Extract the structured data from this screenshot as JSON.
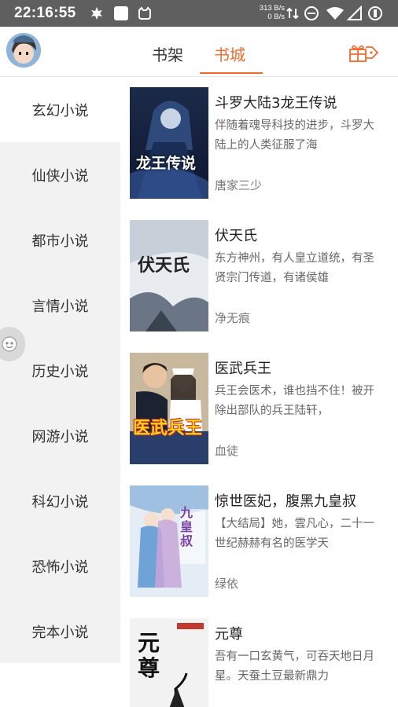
{
  "status_bar": {
    "time": "22:16:55",
    "upload_speed": "313 B/s",
    "download_speed": "0 B/s"
  },
  "header": {
    "tabs": [
      {
        "label": "书架",
        "active": false
      },
      {
        "label": "书城",
        "active": true
      }
    ]
  },
  "colors": {
    "accent": "#f06a2c",
    "sidebar_bg": "#f2f2f2",
    "status_bar_bg": "#5f5f5f"
  },
  "categories": [
    {
      "label": "玄幻小说",
      "active": true
    },
    {
      "label": "仙侠小说",
      "active": false
    },
    {
      "label": "都市小说",
      "active": false
    },
    {
      "label": "言情小说",
      "active": false
    },
    {
      "label": "历史小说",
      "active": false
    },
    {
      "label": "网游小说",
      "active": false
    },
    {
      "label": "科幻小说",
      "active": false
    },
    {
      "label": "恐怖小说",
      "active": false
    },
    {
      "label": "完本小说",
      "active": false
    }
  ],
  "books": [
    {
      "title": "斗罗大陆3龙王传说",
      "description": "伴随着魂导科技的进步，斗罗大陆上的人类征服了海",
      "author": "唐家三少",
      "cover_title": "龙王传说"
    },
    {
      "title": "伏天氏",
      "description": "东方神州，有人皇立道统，有圣贤宗门传道，有诸侯雄",
      "author": "净无痕",
      "cover_title": "伏天氏"
    },
    {
      "title": "医武兵王",
      "description": "兵王会医术，谁也挡不住！被开除出部队的兵王陆轩，",
      "author": "血徒",
      "cover_title": "医武兵王"
    },
    {
      "title": "惊世医妃，腹黑九皇叔",
      "description": "【大结局】她，雲凡心，二十一世纪赫赫有名的医学天",
      "author": "绿依",
      "cover_title": "九皇叔"
    },
    {
      "title": "元尊",
      "description": "吾有一口玄黄气，可吞天地日月星。天蚕土豆最新鼎力",
      "author": "",
      "cover_title": "元尊"
    }
  ]
}
